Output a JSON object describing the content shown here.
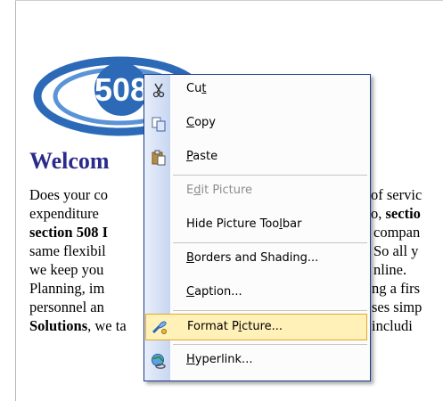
{
  "document": {
    "logo_text": "508",
    "heading": "Welcom",
    "lines": [
      {
        "text": "Does your co",
        "tail": "of servic"
      },
      {
        "text": "expenditure",
        "tail_pre": "o, ",
        "tail_bold": "sectio"
      },
      {
        "bold": "section 508 I",
        "tail": "compan"
      },
      {
        "text": "same flexibil",
        "tail": "So all y"
      },
      {
        "text": "we keep you",
        "tail": "nline."
      },
      {
        "text": "Planning, im",
        "tail": "ng a firs"
      },
      {
        "text": "personnel an",
        "tail": "ses simp"
      },
      {
        "bold": "Solutions",
        "text": ", we ta",
        "tail": "includi"
      }
    ]
  },
  "context_menu": {
    "items": [
      {
        "pre": "Cu",
        "ul": "t",
        "post": "",
        "icon": "scissors-icon"
      },
      {
        "pre": "",
        "ul": "C",
        "post": "opy",
        "icon": "copy-icon"
      },
      {
        "pre": "",
        "ul": "P",
        "post": "aste",
        "icon": "paste-icon"
      },
      {
        "pre": "E",
        "ul": "d",
        "post": "it Picture",
        "disabled": true
      },
      {
        "pre": "Hide Picture Too",
        "ul": "l",
        "post": "bar"
      },
      {
        "pre": "",
        "ul": "B",
        "post": "orders and Shading..."
      },
      {
        "pre": "",
        "ul": "C",
        "post": "aption..."
      },
      {
        "pre": "Format P",
        "ul": "i",
        "post": "cture...",
        "icon": "format-picture-icon",
        "highlighted": true
      },
      {
        "pre": "",
        "ul": "H",
        "post": "yperlink...",
        "icon": "hyperlink-globe-icon"
      }
    ]
  },
  "colors": {
    "heading": "#2b2b8c",
    "menu_border": "#1c3f8f",
    "highlight_fill": "#fff1b8",
    "highlight_border": "#e6a526"
  }
}
